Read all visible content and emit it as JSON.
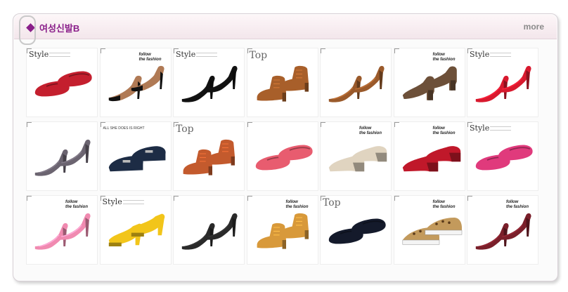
{
  "header": {
    "title": "여성신발B",
    "more_label": "more"
  },
  "colors": {
    "accent": "#8a1f8a",
    "border": "#d8d0d6"
  },
  "products": [
    {
      "tag": "Style",
      "color": "#c41f2e",
      "style": "flat"
    },
    {
      "tag": "follow",
      "color": "#b07a55",
      "style": "pump-dark"
    },
    {
      "tag": "Style",
      "color": "#111111",
      "style": "stiletto"
    },
    {
      "tag": "Top",
      "color": "#a85f2a",
      "style": "bootie"
    },
    {
      "tag": "",
      "color": "#9a5a2b",
      "style": "stiletto"
    },
    {
      "tag": "follow",
      "color": "#6d5039",
      "style": "chunky"
    },
    {
      "tag": "Style",
      "color": "#d8192e",
      "style": "stiletto"
    },
    {
      "tag": "",
      "color": "#6b6470",
      "style": "stiletto"
    },
    {
      "tag": "all",
      "color": "#1d2c45",
      "style": "loafer"
    },
    {
      "tag": "Top",
      "color": "#c35a2d",
      "style": "oxford"
    },
    {
      "tag": "",
      "color": "#e85c6f",
      "style": "flat"
    },
    {
      "tag": "follow",
      "color": "#e0d4c0",
      "style": "wedge"
    },
    {
      "tag": "follow",
      "color": "#c0182a",
      "style": "wedge"
    },
    {
      "tag": "Style",
      "color": "#e03a7c",
      "style": "flat"
    },
    {
      "tag": "follow",
      "color": "#f08ab0",
      "style": "stiletto"
    },
    {
      "tag": "Style",
      "color": "#f2c51a",
      "style": "platform"
    },
    {
      "tag": "",
      "color": "#2a2a2a",
      "style": "stiletto"
    },
    {
      "tag": "follow",
      "color": "#d8993a",
      "style": "oxford"
    },
    {
      "tag": "Top",
      "color": "#141a2b",
      "style": "flat"
    },
    {
      "tag": "follow",
      "color": "#c39a5c",
      "style": "sneaker"
    },
    {
      "tag": "follow",
      "color": "#7a1f2a",
      "style": "stiletto"
    }
  ],
  "tag_text": {
    "style": "Style",
    "top": "Top",
    "follow_line1": "follow",
    "follow_line2": "the fashion",
    "all_line1": "ALL SHE DOES IS RIGHT"
  }
}
